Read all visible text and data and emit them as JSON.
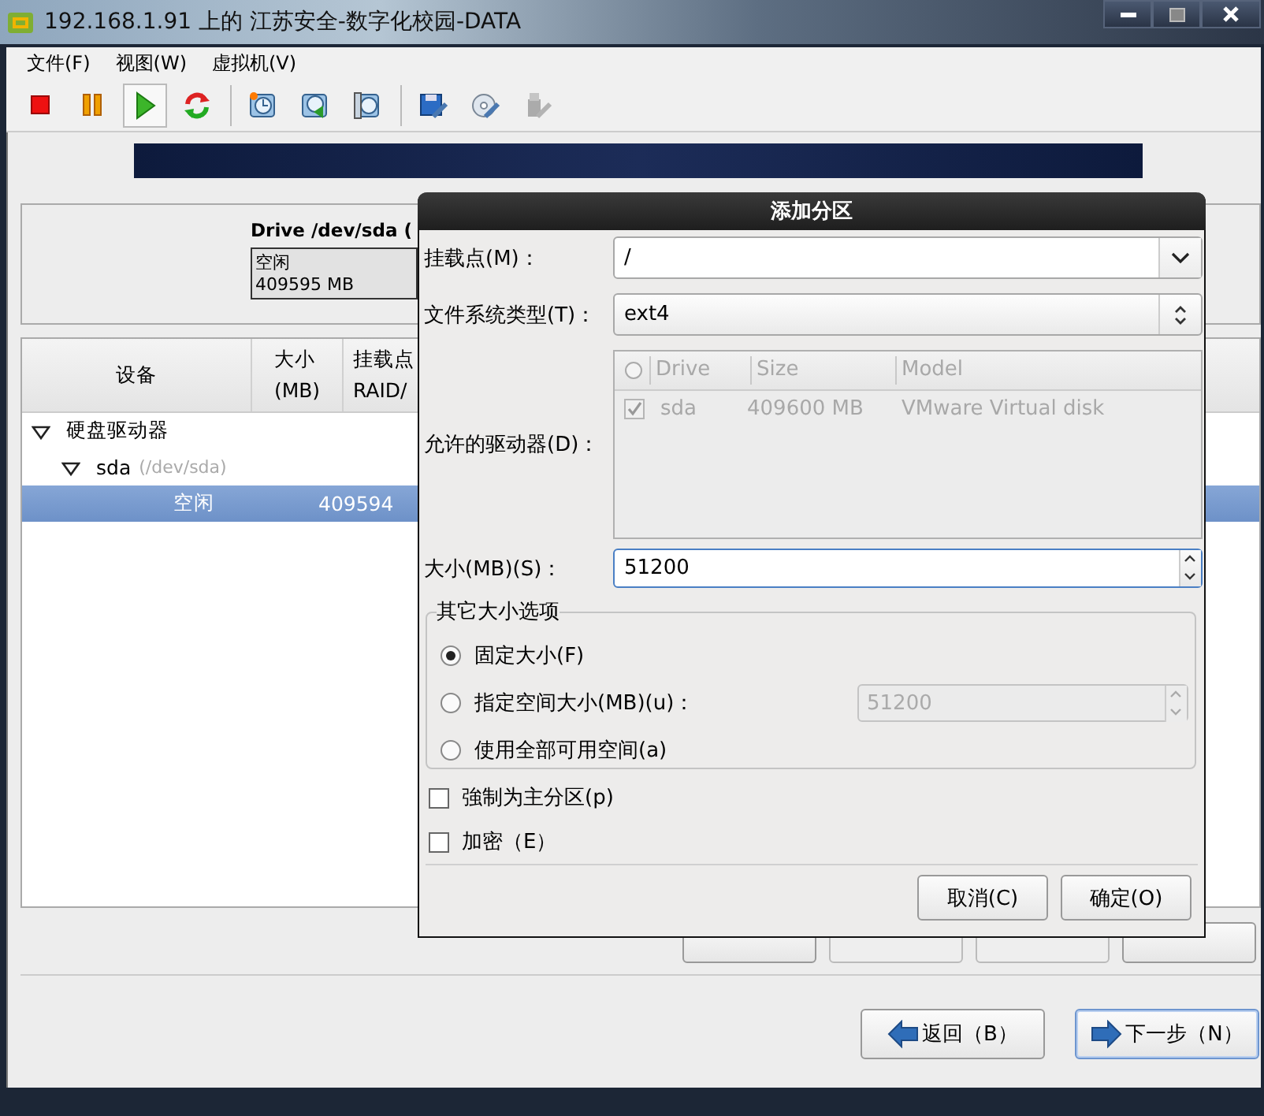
{
  "window": {
    "title": "192.168.1.91 上的 江苏安全-数字化校园-DATA"
  },
  "menu": [
    "文件(F)",
    "视图(W)",
    "虚拟机(V)"
  ],
  "toolbar": [
    {
      "selected": false,
      "disabled": false
    },
    {
      "selected": false,
      "disabled": false
    },
    {
      "selected": true,
      "disabled": false
    },
    {
      "selected": false,
      "disabled": false
    },
    {
      "selected": false,
      "disabled": false
    },
    {
      "selected": false,
      "disabled": false
    },
    {
      "selected": false,
      "disabled": false
    },
    {
      "selected": false,
      "disabled": false
    },
    {
      "selected": false,
      "disabled": false
    },
    {
      "selected": false,
      "disabled": true
    }
  ],
  "drive_panel": {
    "title": "Drive /dev/sda (",
    "segment": {
      "label": "空闲",
      "size": "409595 MB"
    }
  },
  "table": {
    "columns": [
      "设备",
      "大小\n(MB)",
      "挂载点\nRAID/"
    ],
    "rows": [
      {
        "device": "硬盘驱动器",
        "expanded": true,
        "selected": false,
        "children": [
          {
            "device": "sda",
            "note": "(/dev/sda)",
            "expanded": true,
            "selected": false,
            "children": [
              {
                "device": "空闲",
                "size": "409594",
                "selected": true
              }
            ]
          }
        ]
      }
    ]
  },
  "action_buttons": [
    {
      "disabled": false
    },
    {
      "disabled": true
    },
    {
      "disabled": true
    },
    {
      "disabled": false
    }
  ],
  "nav_buttons": [
    {
      "label": "返回（B）",
      "focused": false
    },
    {
      "label": "下一步（N）",
      "focused": true
    }
  ],
  "dialog": {
    "title": "添加分区",
    "mount_point": {
      "label": "挂载点(M)：",
      "value": "/"
    },
    "fs_type": {
      "label": "文件系统类型(T)：",
      "value": "ext4"
    },
    "drives": {
      "label": "允许的驱动器(D)：",
      "columns": [
        "Drive",
        "Size",
        "Model"
      ],
      "rows": [
        {
          "checked": true,
          "drive": "sda",
          "size": "409600 MB",
          "model": "VMware Virtual disk"
        }
      ]
    },
    "size": {
      "label": "大小(MB)(S)：",
      "value": "51200"
    },
    "size_options": {
      "legend": "其它大小选项",
      "options": [
        {
          "label": "固定大小(F)",
          "selected": true
        },
        {
          "label": "指定空间大小(MB)(u)：",
          "selected": false,
          "value": "51200"
        },
        {
          "label": "使用全部可用空间(a)",
          "selected": false
        }
      ]
    },
    "checkboxes": [
      {
        "label": "強制为主分区(p)",
        "checked": false
      },
      {
        "label": "加密（E）",
        "checked": false
      }
    ],
    "buttons": [
      "取消(C)",
      "确定(O)"
    ]
  }
}
